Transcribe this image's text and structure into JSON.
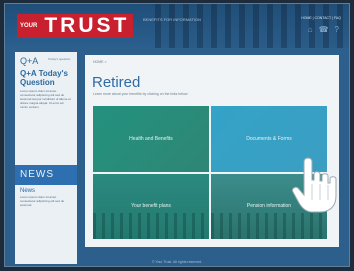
{
  "header": {
    "logo_prefix": "YOUR",
    "logo_main": "TRUST",
    "tagline": "BENEFITS FOR INFORMATION",
    "top_links": "HOME | CONTACT | FAQ",
    "icons": [
      "home-icon",
      "phone-icon",
      "question-icon"
    ]
  },
  "sidebar": {
    "qa_label": "Q+A",
    "qa_sub": "Today's question",
    "qa_heading": "Q+A Today's Question",
    "qa_text": "Lorem ipsum dolor sit amet consectetur adipiscing elit sed do eiusmod tempor incididunt ut labore et dolore magna aliqua. Ut enim ad minim veniam.",
    "news_label": "NEWS",
    "news_heading": "News",
    "news_text": "Lorem ipsum dolor sit amet consectetur adipiscing elit sed do eiusmod."
  },
  "main": {
    "breadcrumb": "HOME >",
    "title": "Retired",
    "subtitle": "Learn more about your benefits by clicking on the links below",
    "tiles": [
      {
        "label": "Health and Benefits"
      },
      {
        "label": "Documents & Forms"
      },
      {
        "label": "Your benefit plans"
      },
      {
        "label": "Pension information"
      }
    ]
  },
  "footer": {
    "text": "© Your Trust. All rights reserved."
  },
  "colors": {
    "brand_red": "#c8202e",
    "accent_blue": "#2e6ca6",
    "tile_teal": "#23917e",
    "tile_cyan": "#33a3c7"
  }
}
